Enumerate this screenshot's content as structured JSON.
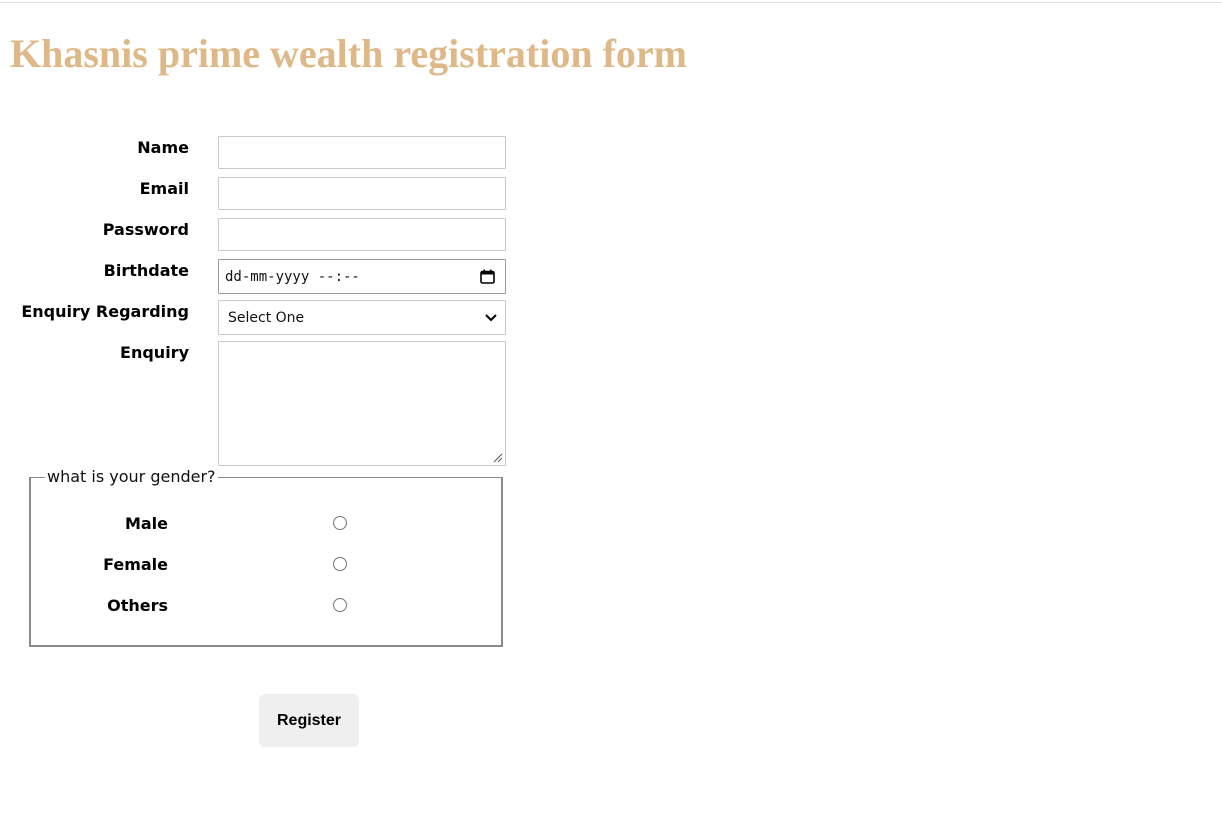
{
  "page": {
    "title": "Khasnis prime wealth registration form",
    "title_color": "#deb887"
  },
  "form": {
    "name_label": "Name",
    "email_label": "Email",
    "password_label": "Password",
    "birthdate_label": "Birthdate",
    "birthdate_placeholder": "dd-mm-yyyy --:--",
    "enquiry_regarding_label": "Enquiry Regarding",
    "enquiry_regarding_selected": "Select One",
    "enquiry_label": "Enquiry"
  },
  "gender": {
    "legend": "what is your gender?",
    "options": [
      "Male",
      "Female",
      "Others"
    ]
  },
  "actions": {
    "register_label": "Register"
  },
  "icons": {
    "calendar": "calendar-icon",
    "dropdown": "chevron-down-icon",
    "resize": "resize-handle-icon"
  }
}
